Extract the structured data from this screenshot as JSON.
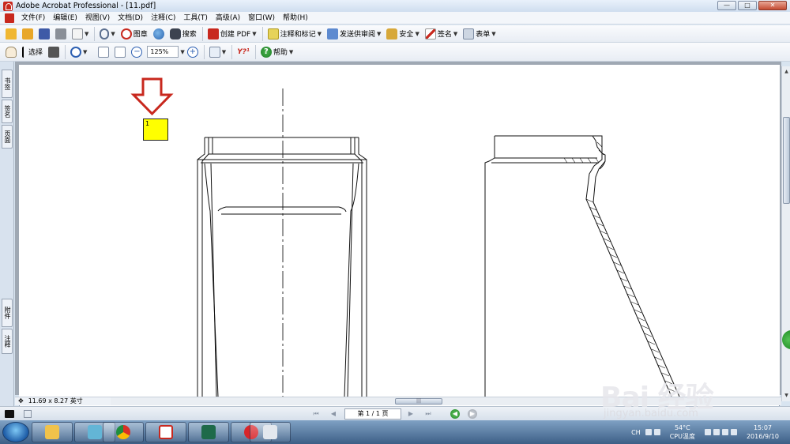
{
  "window": {
    "title": "Adobe Acrobat Professional - [11.pdf]",
    "minimize": "—",
    "maximize": "□",
    "close": "✕"
  },
  "menu": {
    "items": [
      "文件(F)",
      "编辑(E)",
      "视图(V)",
      "文档(D)",
      "注释(C)",
      "工具(T)",
      "高级(A)",
      "窗口(W)",
      "帮助(H)"
    ]
  },
  "toolbar1": {
    "stamp_label": "图章",
    "search_label": "搜索",
    "create_pdf_label": "创建 PDF",
    "comment_label": "注释和标记",
    "review_label": "发送供审阅",
    "security_label": "安全",
    "sign_label": "签名",
    "forms_label": "表单"
  },
  "toolbar2": {
    "select_label": "选择",
    "zoom_value": "125%",
    "yhi_label": "Y?¹",
    "help_label": "帮助"
  },
  "sidebar": {
    "tabs": [
      "书签",
      "签名",
      "页面",
      "附件",
      "注释"
    ]
  },
  "note": {
    "text": "1"
  },
  "page_size": {
    "value": "11.69 x 8.27 英寸"
  },
  "navigation": {
    "page_indicator": "第 1 / 1 页"
  },
  "taskbar": {
    "language": "CH",
    "temperature": "54°C",
    "temp_label": "CPU温度",
    "time": "15:07",
    "date": "2016/9/10"
  },
  "watermark": {
    "title": "Bai 经验",
    "url": "jingyan.baidu.com"
  },
  "colors": {
    "note_fill": "#ffff00",
    "arrow": "#c8281e",
    "titlebar": "#dbe6f3"
  }
}
